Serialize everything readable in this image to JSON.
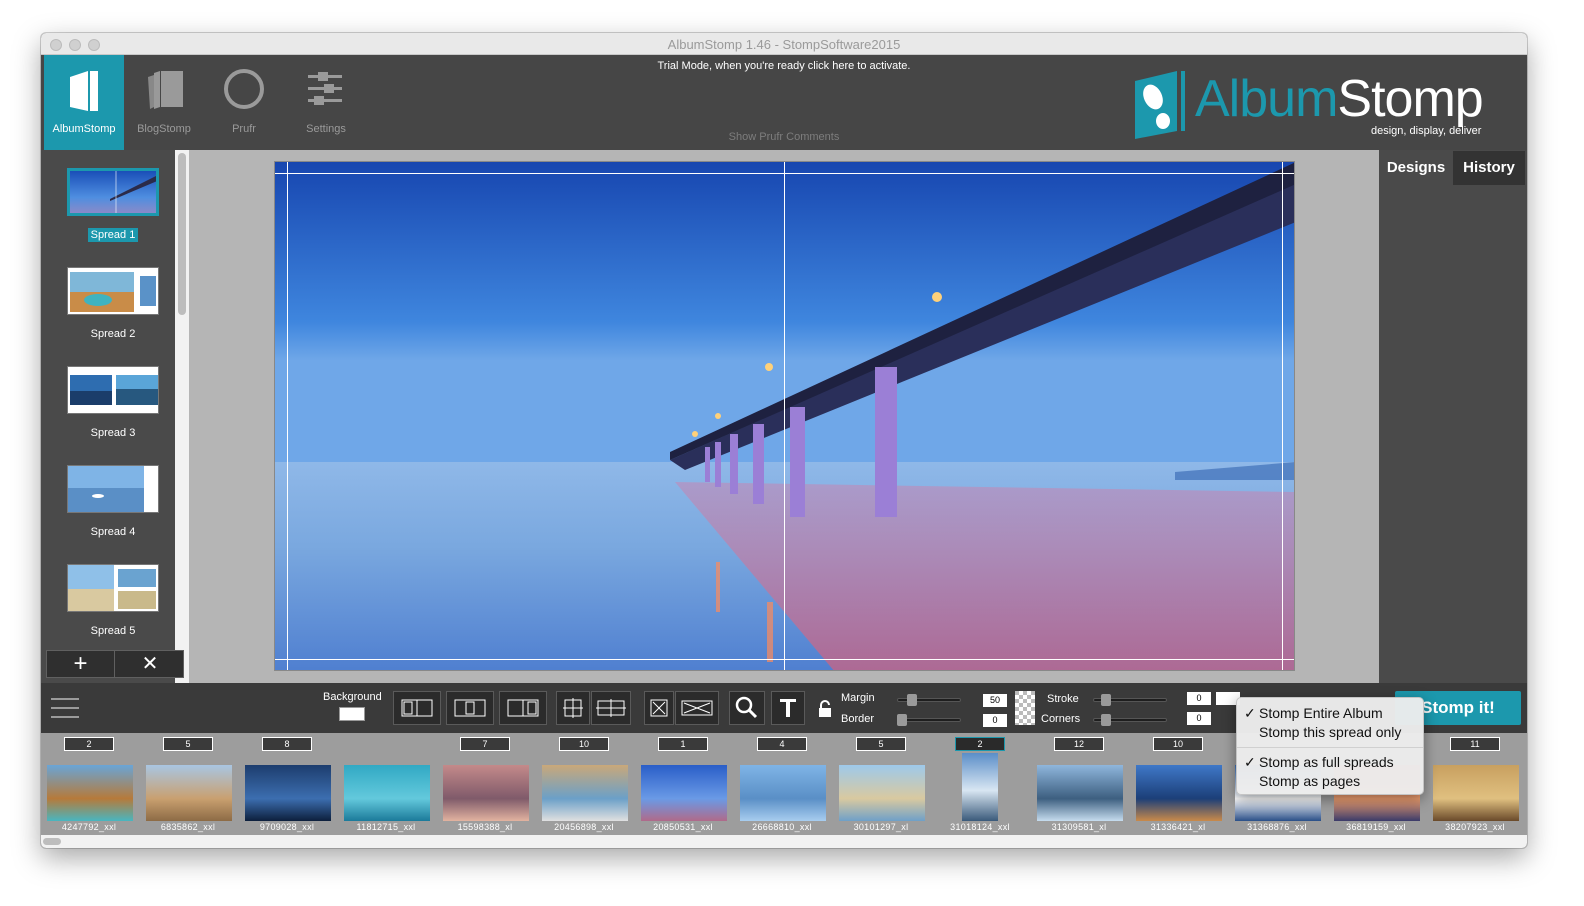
{
  "window": {
    "title": "AlbumStomp 1.46 - StompSoftware2015"
  },
  "toolbar": {
    "modes": [
      {
        "label": "AlbumStomp",
        "icon": "albumstomp-page-icon",
        "active": true
      },
      {
        "label": "BlogStomp",
        "icon": "blogstomp-icon",
        "active": false
      },
      {
        "label": "Prufr",
        "icon": "prufr-circle-icon",
        "active": false
      },
      {
        "label": "Settings",
        "icon": "settings-sliders-icon",
        "active": false
      }
    ],
    "trial_text": "Trial Mode, when you're ready click here to activate.",
    "show_prufr_comments": "Show Prufr Comments"
  },
  "logo": {
    "word_a": "Album",
    "word_b": "Stomp",
    "tagline": "design, display, deliver"
  },
  "sidebar": {
    "spreads": [
      {
        "label": "Spread 1"
      },
      {
        "label": "Spread 2"
      },
      {
        "label": "Spread 3"
      },
      {
        "label": "Spread 4"
      },
      {
        "label": "Spread 5"
      }
    ],
    "add_label": "+",
    "remove_label": "✕"
  },
  "right_panel": {
    "tabs": [
      "Designs",
      "History"
    ]
  },
  "bottom": {
    "background_label": "Background",
    "margin_label": "Margin",
    "border_label": "Border",
    "stroke_label": "Stroke",
    "corners_label": "Corners",
    "margin_value": "50",
    "border_value": "0",
    "stroke_value": "0",
    "corners_value": "0",
    "stomp_label": "Stomp it!"
  },
  "stomp_menu": {
    "items": [
      {
        "label": "Stomp Entire Album",
        "checked": true
      },
      {
        "label": "Stomp this spread only",
        "checked": false
      },
      {
        "label": "Stomp as full spreads",
        "checked": true
      },
      {
        "label": "Stomp as pages",
        "checked": false
      }
    ]
  },
  "filmstrip": [
    {
      "count": "2",
      "name": "4247792_xxl"
    },
    {
      "count": "5",
      "name": "6835862_xxl"
    },
    {
      "count": "8",
      "name": "9709028_xxl"
    },
    {
      "count": "",
      "name": "11812715_xxl"
    },
    {
      "count": "7",
      "name": "15598388_xl"
    },
    {
      "count": "10",
      "name": "20456898_xxl"
    },
    {
      "count": "1",
      "name": "20850531_xxl"
    },
    {
      "count": "4",
      "name": "26668810_xxl"
    },
    {
      "count": "5",
      "name": "30101297_xl"
    },
    {
      "count": "2",
      "name": "31018124_xxl"
    },
    {
      "count": "12",
      "name": "31309581_xl"
    },
    {
      "count": "10",
      "name": "31336421_xl"
    },
    {
      "count": "",
      "name": "31368876_xxl"
    },
    {
      "count": "",
      "name": "36819159_xxl"
    },
    {
      "count": "11",
      "name": "38207923_xxl"
    }
  ]
}
